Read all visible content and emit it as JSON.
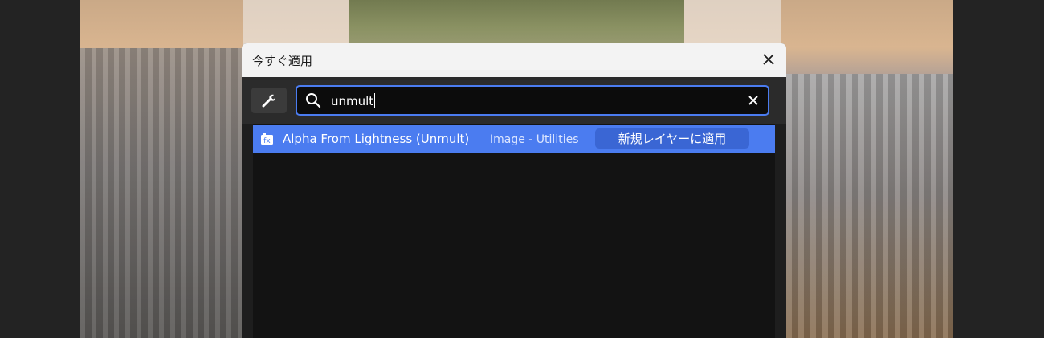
{
  "dialog": {
    "title": "今すぐ適用",
    "close_icon": "close-icon"
  },
  "toolbar": {
    "settings_icon": "wrench-icon"
  },
  "search": {
    "value": "unmult",
    "icon": "search-icon",
    "clear_icon": "clear-icon"
  },
  "results": [
    {
      "name": "Alpha From Lightness (Unmult)",
      "category": "Image - Utilities",
      "action_label": "新規レイヤーに適用",
      "icon": "effect-icon"
    }
  ],
  "colors": {
    "accent": "#4b7cf0",
    "accent_dark": "#3a66d4",
    "title_bar": "#f3f3f3",
    "panel": "#2b2b2b",
    "list_bg": "#131313"
  }
}
